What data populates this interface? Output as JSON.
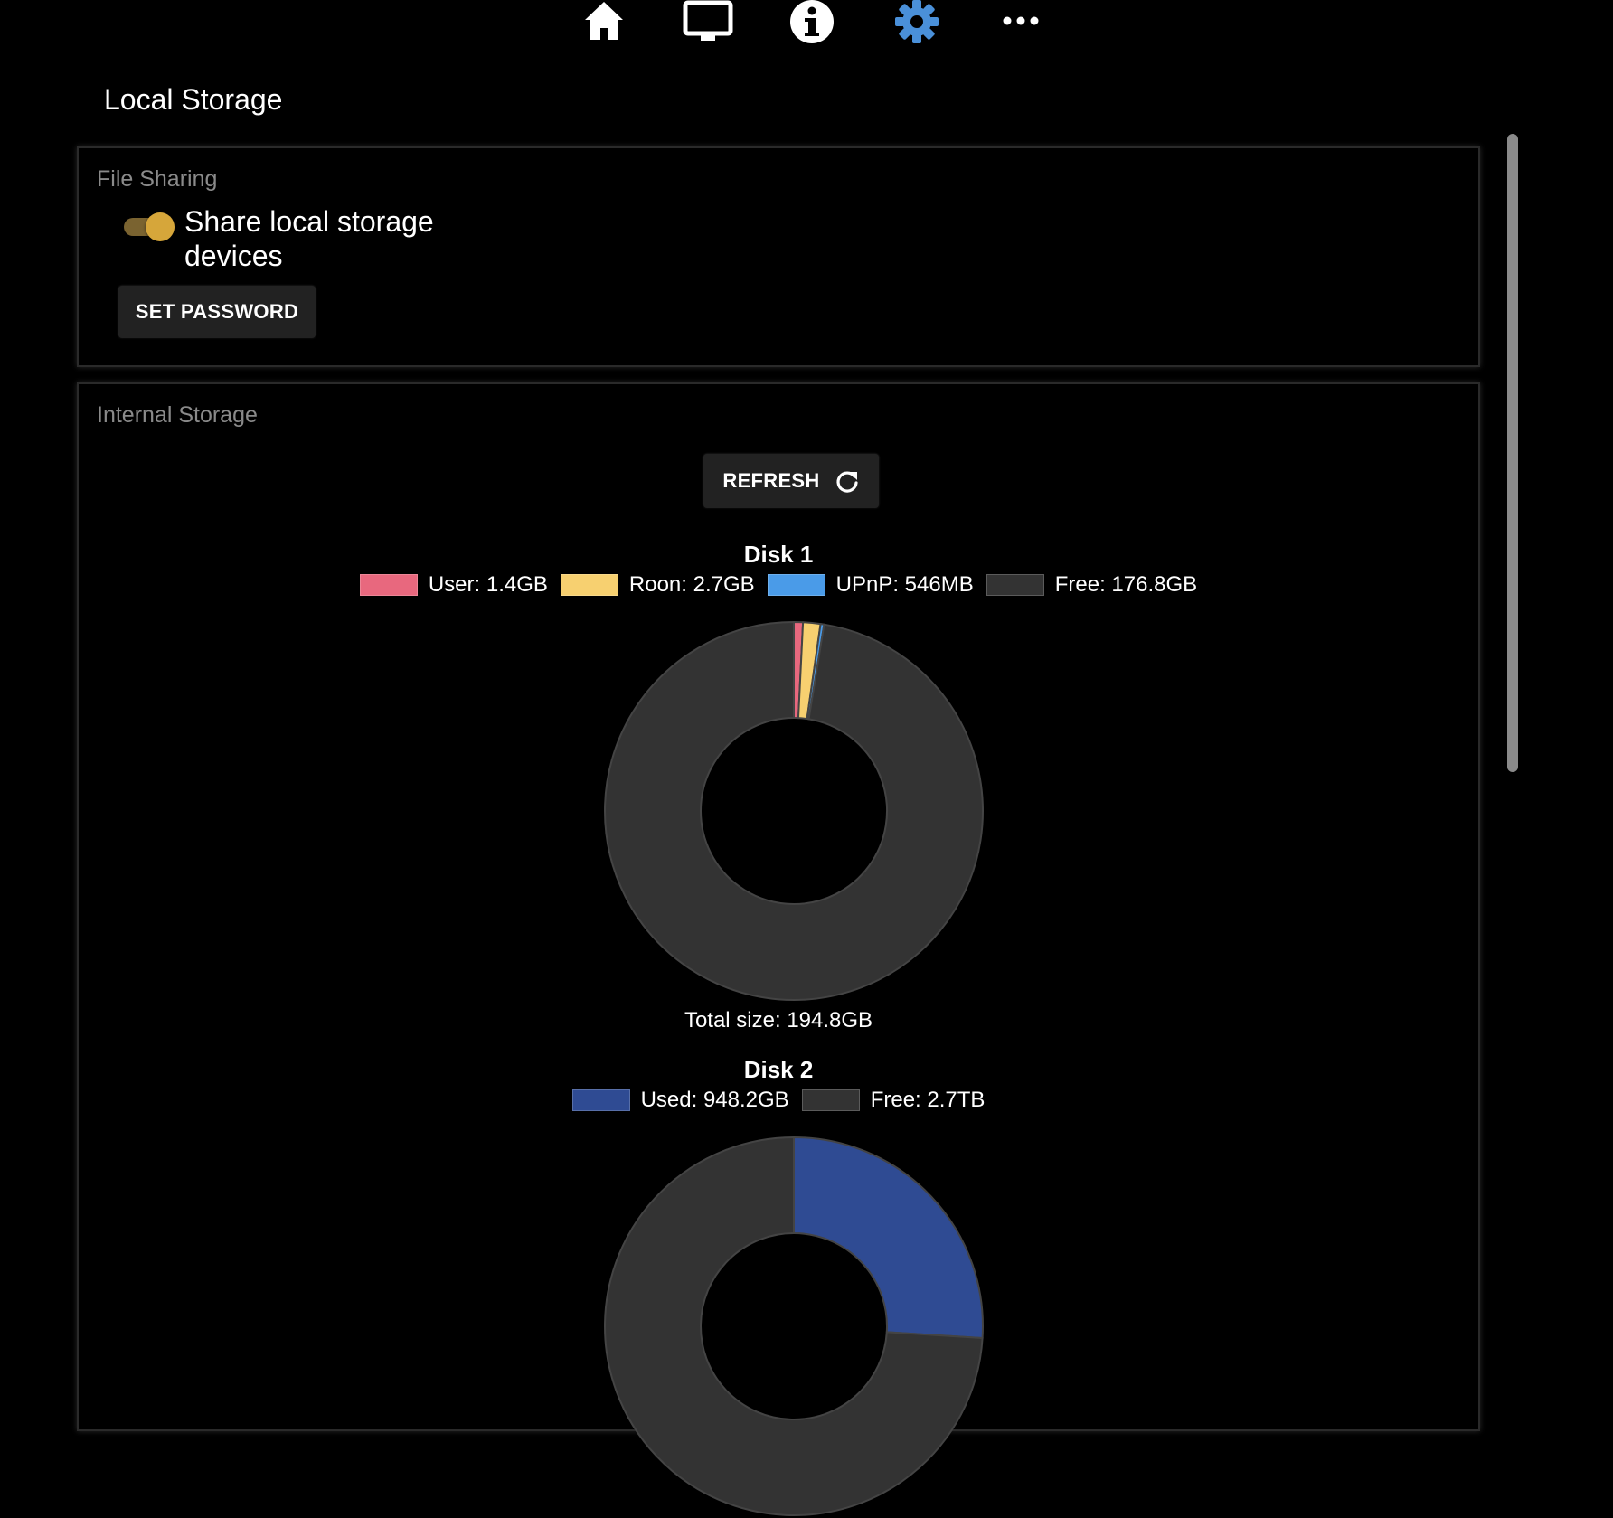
{
  "nav": {
    "icons": [
      "home-icon",
      "monitor-icon",
      "info-icon",
      "gear-icon",
      "more-icon"
    ],
    "active": "gear-icon",
    "active_color": "#4a90d9"
  },
  "page": {
    "title": "Local Storage"
  },
  "file_sharing": {
    "label": "File Sharing",
    "toggle_label": "Share local storage devices",
    "toggle_on": true,
    "toggle_color": "#d6a63a",
    "set_password_label": "SET PASSWORD"
  },
  "internal_storage": {
    "label": "Internal Storage",
    "refresh_label": "REFRESH"
  },
  "chart_data": [
    {
      "type": "pie",
      "title": "Disk 1",
      "series": [
        {
          "name": "User",
          "label": "User: 1.4GB",
          "value": 1.4,
          "color": "#e8687e"
        },
        {
          "name": "Roon",
          "label": "Roon: 2.7GB",
          "value": 2.7,
          "color": "#f7d070"
        },
        {
          "name": "UPnP",
          "label": "UPnP: 546MB",
          "value": 0.546,
          "color": "#4a9be8"
        },
        {
          "name": "Free",
          "label": "Free: 176.8GB",
          "value": 176.8,
          "color": "#333333"
        }
      ],
      "total_label": "Total size: 194.8GB"
    },
    {
      "type": "pie",
      "title": "Disk 2",
      "series": [
        {
          "name": "Used",
          "label": "Used: 948.2GB",
          "value": 948.2,
          "color": "#2f4b93"
        },
        {
          "name": "Free",
          "label": "Free: 2.7TB",
          "value": 2700,
          "color": "#333333"
        }
      ]
    }
  ]
}
